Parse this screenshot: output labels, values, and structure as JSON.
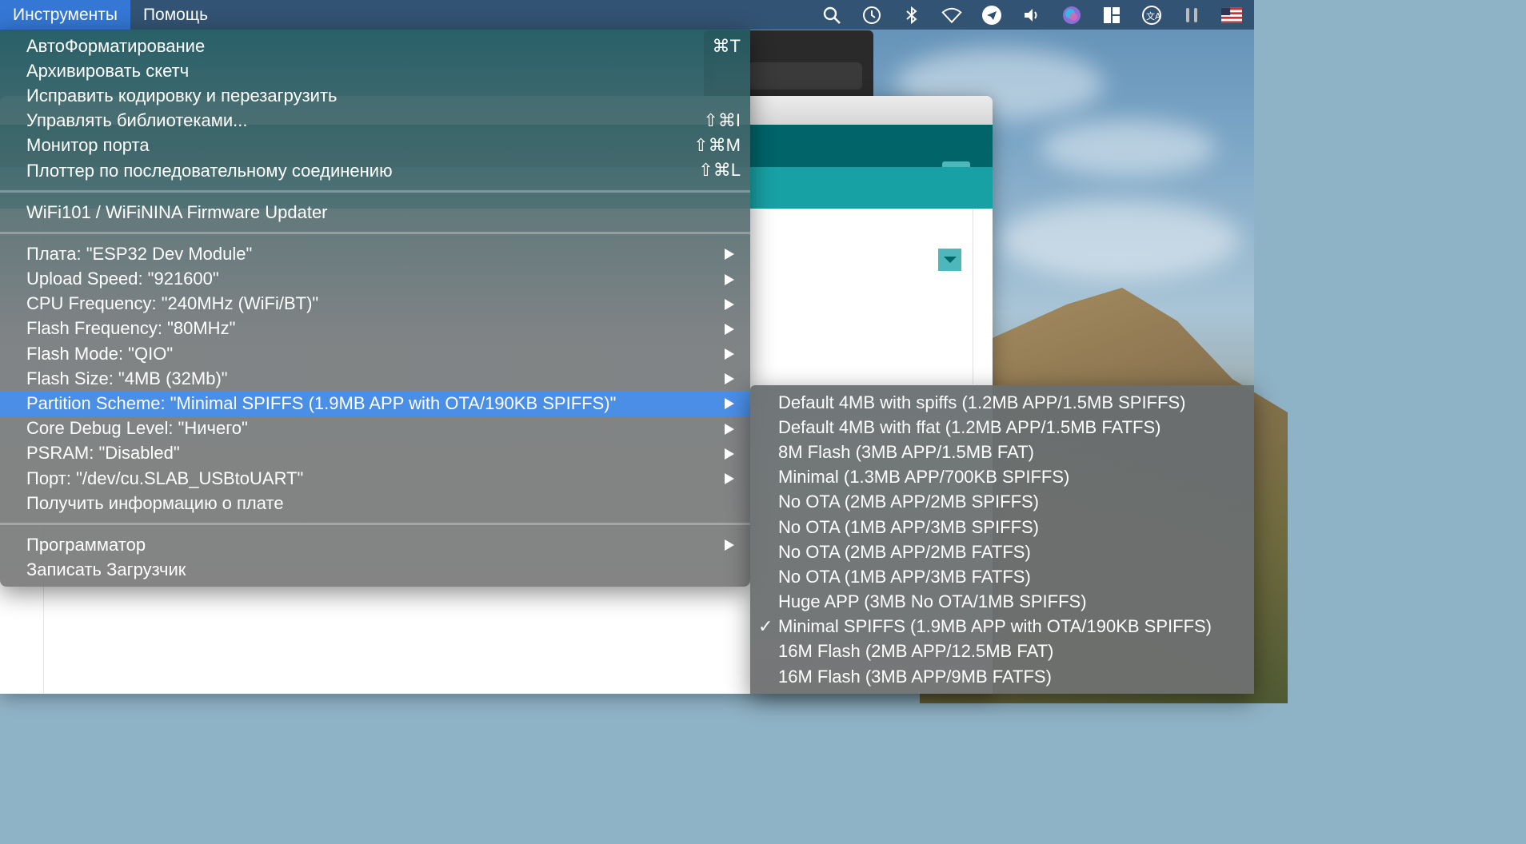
{
  "menubar": {
    "items": [
      "Инструменты",
      "Помощь"
    ],
    "status_icons": [
      "spotlight-search-icon",
      "time-machine-icon",
      "bluetooth-icon",
      "wifi-icon",
      "telegram-icon",
      "volume-icon",
      "siri-icon",
      "window-manager-icon",
      "translate-icon",
      "airpods-icon",
      "us-flag-icon"
    ]
  },
  "menu": {
    "items": [
      {
        "label": "АвтоФорматирование",
        "shortcut": "⌘T"
      },
      {
        "label": "Архивировать скетч",
        "shortcut": ""
      },
      {
        "label": "Исправить кодировку и перезагрузить",
        "shortcut": ""
      },
      {
        "label": "Управлять библиотеками...",
        "shortcut": "⇧⌘I"
      },
      {
        "label": "Монитор порта",
        "shortcut": "⇧⌘M"
      },
      {
        "label": "Плоттер по последовательному соединению",
        "shortcut": "⇧⌘L"
      },
      {
        "label": "WiFi101 / WiFiNINA Firmware Updater"
      },
      {
        "label": "Плата: \"ESP32 Dev Module\""
      },
      {
        "label": "Upload Speed: \"921600\""
      },
      {
        "label": "CPU Frequency: \"240MHz (WiFi/BT)\""
      },
      {
        "label": "Flash Frequency: \"80MHz\""
      },
      {
        "label": "Flash Mode: \"QIO\""
      },
      {
        "label": "Flash Size: \"4MB (32Mb)\""
      },
      {
        "label": "Partition Scheme: \"Minimal SPIFFS (1.9MB APP with OTA/190KB SPIFFS)\""
      },
      {
        "label": "Core Debug Level: \"Ничего\""
      },
      {
        "label": "PSRAM: \"Disabled\""
      },
      {
        "label": "Порт: \"/dev/cu.SLAB_USBtoUART\""
      },
      {
        "label": "Получить информацию о плате"
      },
      {
        "label": "Программатор"
      },
      {
        "label": "Записать Загрузчик"
      }
    ]
  },
  "submenu": {
    "checkmark": "✓",
    "items": [
      "Default 4MB with spiffs (1.2MB APP/1.5MB SPIFFS)",
      "Default 4MB with ffat (1.2MB APP/1.5MB FATFS)",
      "8M Flash (3MB APP/1.5MB FAT)",
      "Minimal (1.3MB APP/700KB SPIFFS)",
      "No OTA (2MB APP/2MB SPIFFS)",
      "No OTA (1MB APP/3MB SPIFFS)",
      "No OTA (2MB APP/2MB FATFS)",
      "No OTA (1MB APP/3MB FATFS)",
      "Huge APP (3MB No OTA/1MB SPIFFS)",
      "Minimal SPIFFS (1.9MB APP with OTA/190KB SPIFFS)",
      "16M Flash (2MB APP/12.5MB FAT)",
      "16M Flash (3MB APP/9MB FATFS)"
    ],
    "selected": "Minimal SPIFFS (1.9MB APP with OTA/190KB SPIFFS)"
  },
  "colors": {
    "highlight": "#4b8ee6",
    "menubar_active": "#3477d4",
    "arduino_teal_dark": "#006468",
    "arduino_teal": "#17a1a5"
  }
}
